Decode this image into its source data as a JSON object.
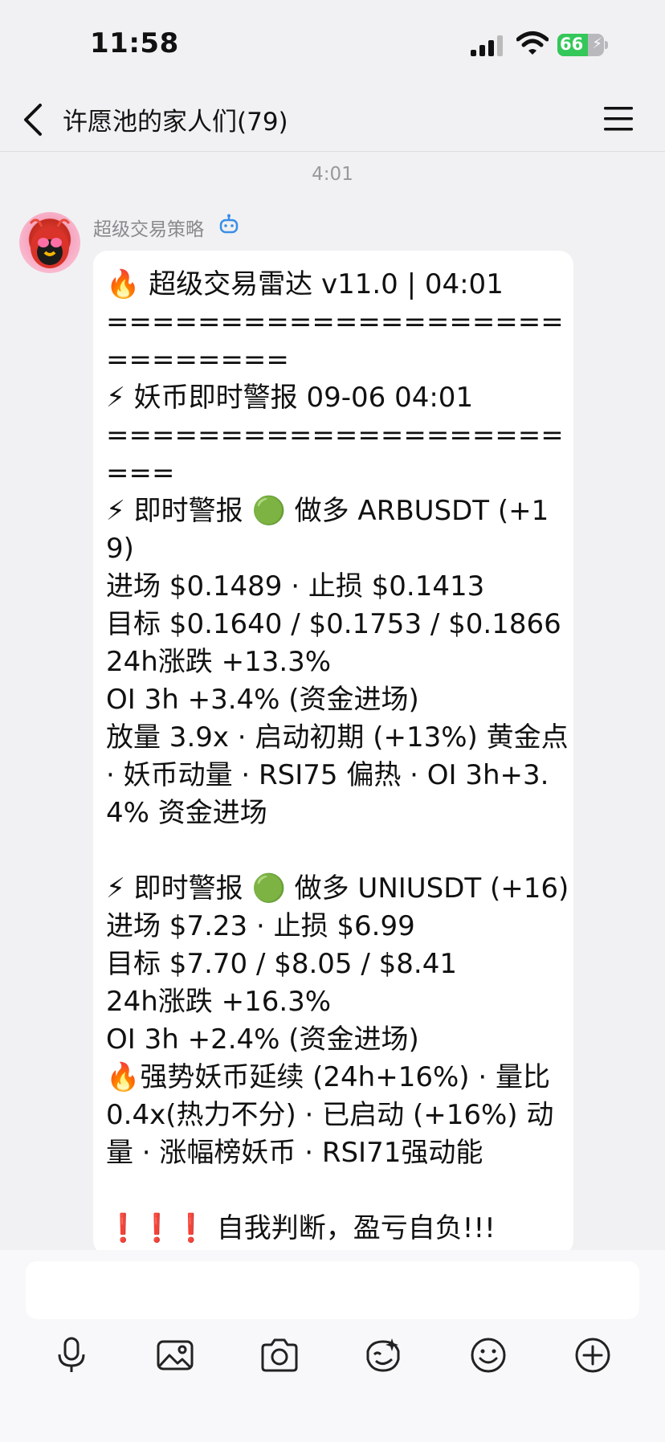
{
  "status_bar": {
    "time": "11:58",
    "battery_level": "66",
    "battery_fraction": 0.66,
    "icons": [
      "cellular-signal-icon",
      "wifi-icon",
      "battery-charging-icon"
    ]
  },
  "nav": {
    "back_icon": "chevron-left-icon",
    "title": "许愿池的家人们(79)",
    "menu_icon": "hamburger-menu-icon"
  },
  "chat": {
    "timestamp": "4:01",
    "sender": {
      "name": "超级交易策略",
      "badge_icon": "robot-icon",
      "avatar": "red-penguin-avatar"
    },
    "message": "🔥 超级交易雷达 v11.0 | 04:01\n============================\n⚡ 妖币即时警报 09-06 04:01\n=======================\n⚡ 即时警报 🟢 做多 ARBUSDT (+19)\n进场 $0.1489 · 止损 $0.1413\n目标 $0.1640 / $0.1753 / $0.1866\n24h涨跌 +13.3%\nOI 3h +3.4% (资金进场)\n放量 3.9x · 启动初期 (+13%) 黄金点 · 妖币动量 · RSI75 偏热 · OI 3h+3.4% 资金进场\n\n⚡ 即时警报 🟢 做多 UNIUSDT (+16)\n进场 $7.23 · 止损 $6.99\n目标 $7.70 / $8.05 / $8.41\n24h涨跌 +16.3%\nOI 3h +2.4% (资金进场)\n🔥强势妖币延续 (24h+16%) · 量比 0.4x(热力不分) · 已启动 (+16%) 动量 · 涨幅榜妖币 · RSI71强动能\n\n❗❗❗ 自我判断，盈亏自负!!!"
  },
  "input_bar": {
    "placeholder": "",
    "tools": [
      "microphone-icon",
      "image-icon",
      "camera-icon",
      "emoji-sticker-icon",
      "smiley-icon",
      "plus-icon"
    ]
  },
  "colors": {
    "background": "#f1f1f3",
    "bubble": "#ffffff",
    "battery": "#34c759",
    "bot_badge": "#3a8ee6"
  }
}
